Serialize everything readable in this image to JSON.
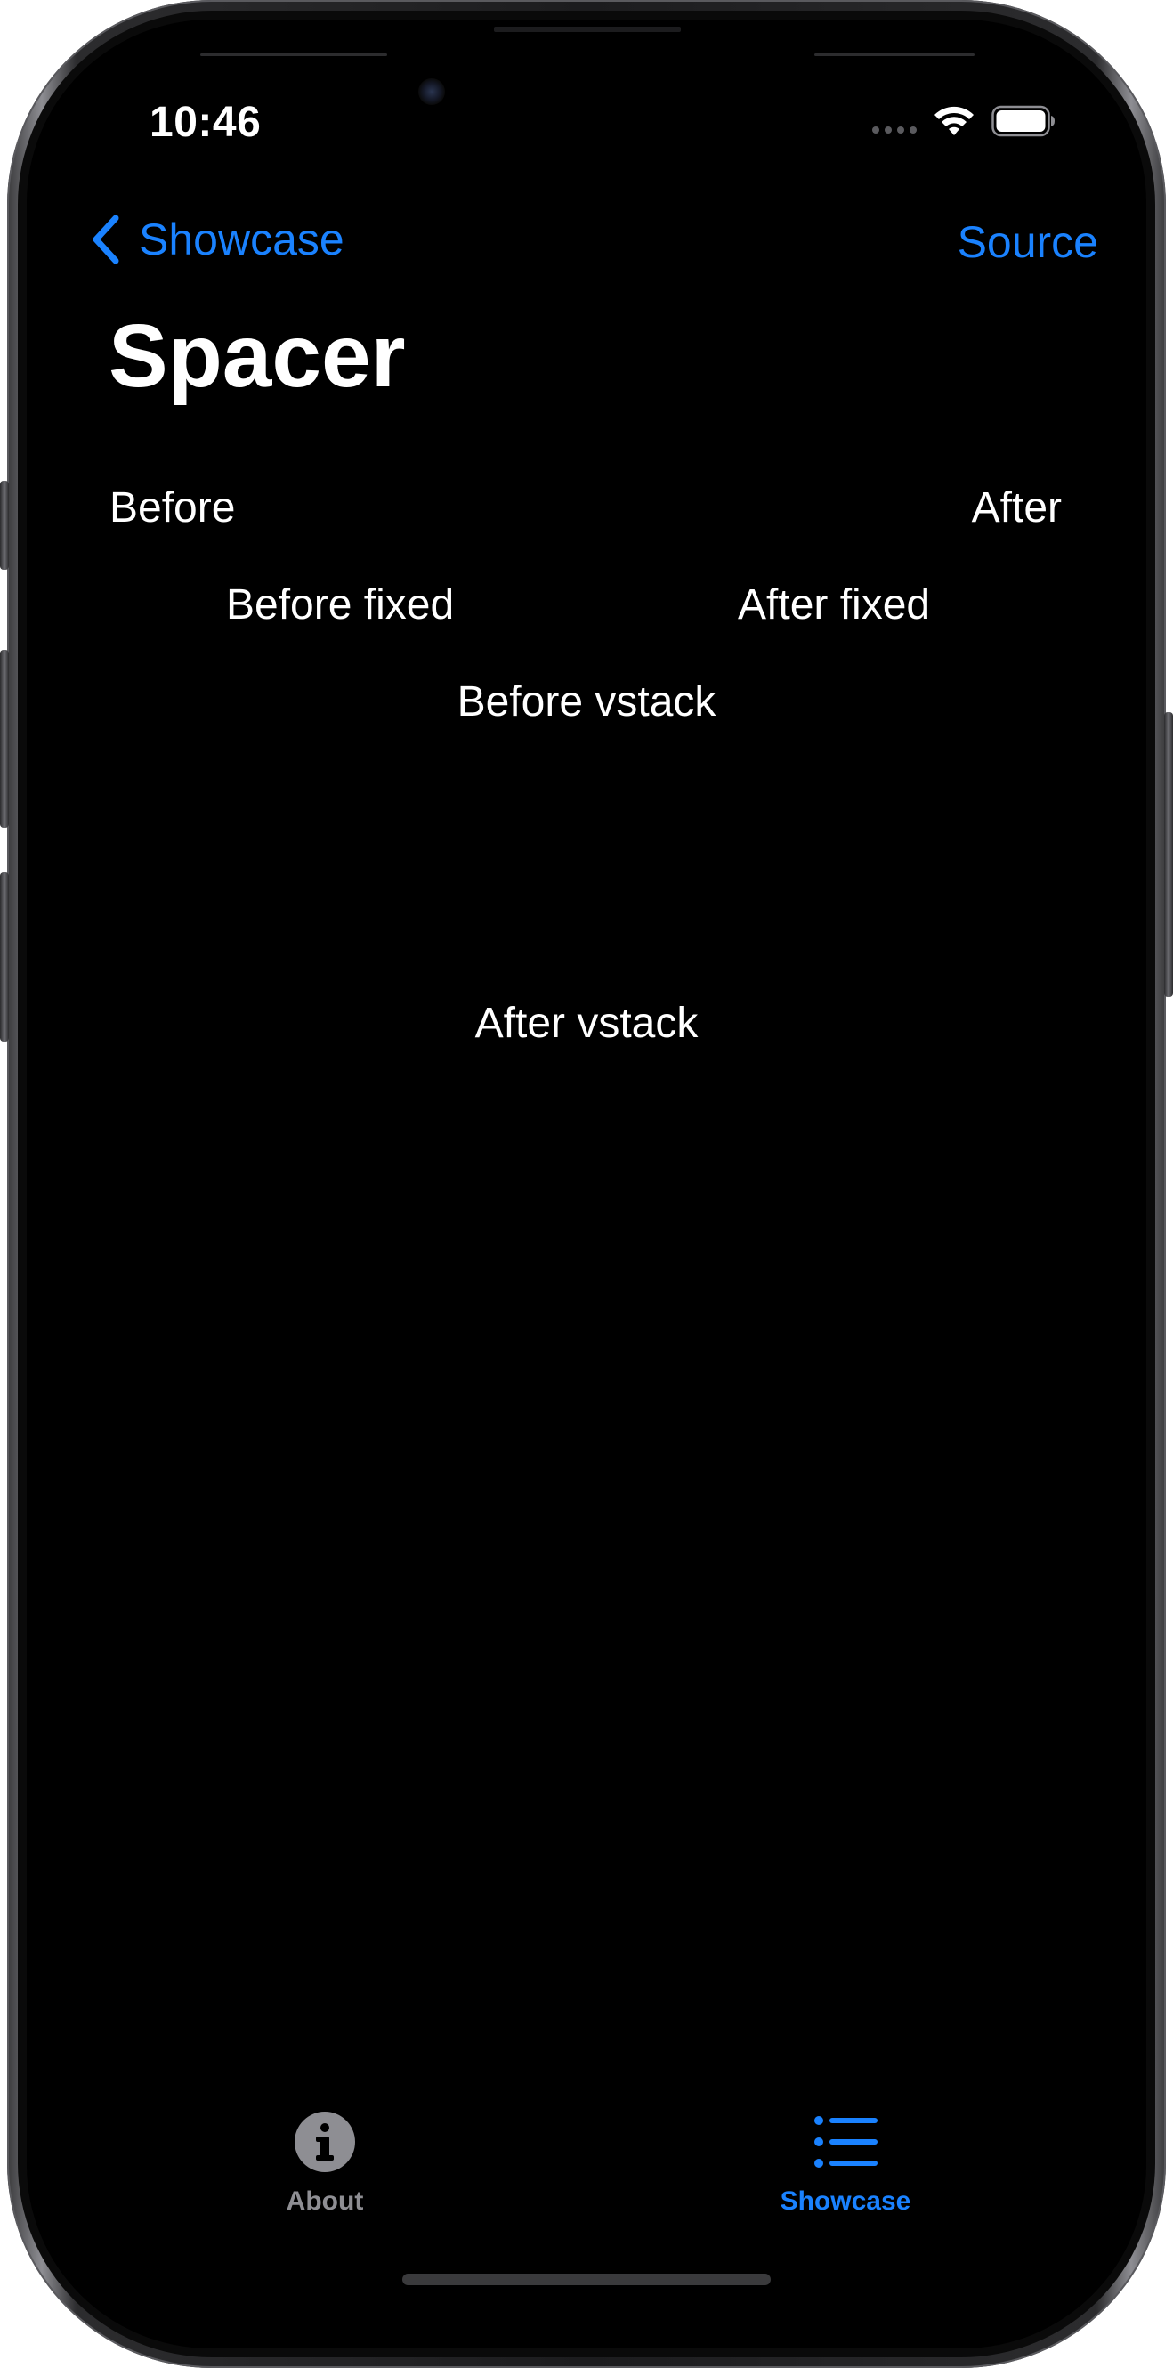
{
  "status_bar": {
    "time": "10:46",
    "icons": [
      "cellular-signal-icon",
      "wifi-icon",
      "battery-icon"
    ]
  },
  "nav": {
    "back_label": "Showcase",
    "right_action": "Source",
    "title": "Spacer"
  },
  "content": {
    "row1_left": "Before",
    "row1_right": "After",
    "row2_left": "Before fixed",
    "row2_right": "After fixed",
    "vstack_before": "Before vstack",
    "vstack_after": "After vstack"
  },
  "tab_bar": {
    "tabs": [
      {
        "label": "About",
        "icon": "info-circle-icon",
        "selected": false
      },
      {
        "label": "Showcase",
        "icon": "list-bullet-icon",
        "selected": true
      }
    ]
  },
  "colors": {
    "accent": "#1a82ff",
    "background": "#000000",
    "text": "#ffffff",
    "tab_inactive": "#8e8e93"
  }
}
